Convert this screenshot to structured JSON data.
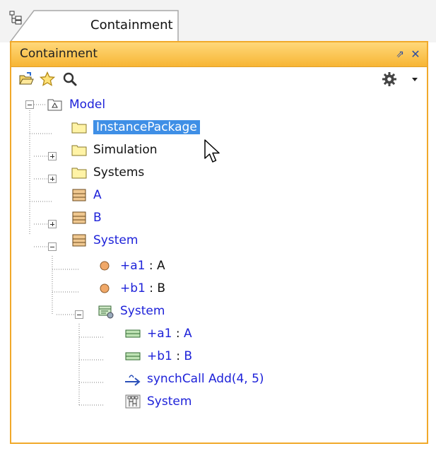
{
  "tab": {
    "label": "Containment"
  },
  "panel": {
    "title": "Containment"
  },
  "toolbar": {
    "icons": [
      "open-folder-icon",
      "star-icon",
      "search-icon",
      "gear-icon",
      "dropdown-arrow-icon"
    ]
  },
  "tree": {
    "model": "Model",
    "instance_package": "InstancePackage",
    "simulation": "Simulation",
    "systems": "Systems",
    "a": "A",
    "b": "B",
    "system": "System",
    "a1": {
      "name": "+a1",
      "sep": " : ",
      "type": "A"
    },
    "b1": {
      "name": "+b1",
      "sep": " : ",
      "type": "B"
    },
    "inner_system": "System",
    "inner_a1": {
      "name": "+a1",
      "sep": " : ",
      "type": "A"
    },
    "inner_b1": {
      "name": "+b1",
      "sep": " : ",
      "type": "B"
    },
    "synch_call": "synchCall Add(4, 5)",
    "diagram": "System"
  },
  "colors": {
    "title_bar": "#f7b534",
    "link_blue": "#1e22d9",
    "selection": "#3f8fe6",
    "frame": "#f1a92a"
  }
}
